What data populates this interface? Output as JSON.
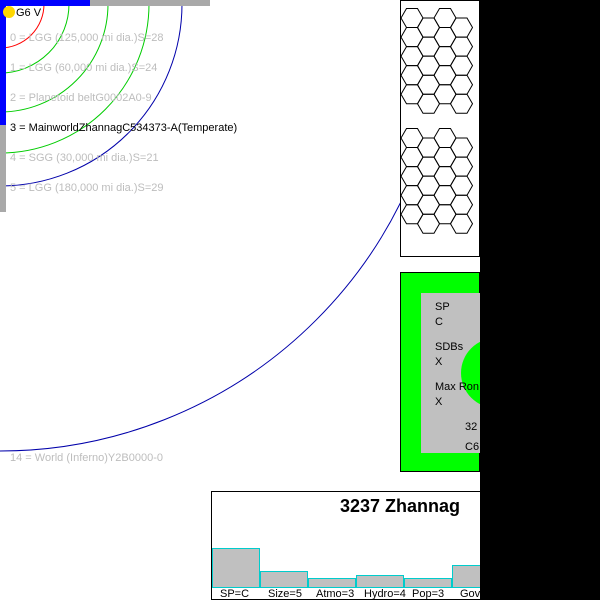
{
  "orbits": {
    "star_label": "G6 V",
    "items": [
      {
        "text": "0 = LGG (125,000 mi dia.)S=28",
        "active": false
      },
      {
        "text": "1 = LGG (60,000 mi dia.)S=24",
        "active": false
      },
      {
        "text": "2 = Planetoid beltG0002A0-9",
        "active": false
      },
      {
        "text": "3 = MainworldZhannagC534373-A(Temperate)",
        "active": true
      },
      {
        "text": "4 = SGG (30,000 mi dia.)S=21",
        "active": false
      },
      {
        "text": "5 = LGG (180,000 mi dia.)S=29",
        "active": false
      }
    ],
    "outer_item": {
      "text": "14 = World (Inferno)Y2B0000-0",
      "active": false
    },
    "colors": {
      "orbit_red": "#ff0000",
      "orbit_green": "#00cc00",
      "orbit_blue": "#0000aa",
      "star": "#ffd700"
    }
  },
  "panel": {
    "lines": [
      "SP",
      "C",
      "SDBs",
      "X",
      "Max Ron",
      "X",
      "32",
      "C6"
    ],
    "colors": {
      "outer": "#00ff00",
      "inner": "#c0c0c0"
    }
  },
  "chart_data": {
    "type": "bar",
    "title": "3237 Zhannag",
    "categories": [
      "SP=C",
      "Size=5",
      "Atmo=3",
      "Hydro=4",
      "Pop=3",
      "Gov"
    ],
    "values": [
      12,
      5,
      3,
      4,
      3,
      7
    ],
    "ylim": [
      0,
      20
    ]
  }
}
